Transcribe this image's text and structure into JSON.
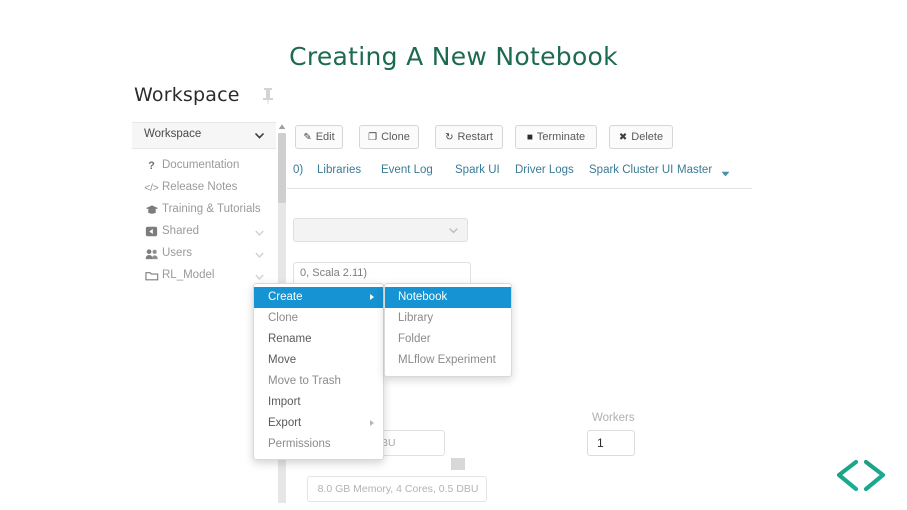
{
  "slide": {
    "title": "Creating A New Notebook",
    "title_color": "#1d6b4f"
  },
  "workspace_panel": {
    "header_title": "Workspace",
    "pin_icon": "pin-icon",
    "selector": {
      "label": "Workspace",
      "caret_icon": "chevron-down-icon"
    },
    "items": [
      {
        "label": "Documentation",
        "icon": "question-mark-icon",
        "has_caret": false
      },
      {
        "label": "Release Notes",
        "icon": "code-brackets-icon",
        "has_caret": false
      },
      {
        "label": "Training & Tutorials",
        "icon": "graduation-cap-icon",
        "has_caret": false
      },
      {
        "label": "Shared",
        "icon": "share-icon",
        "has_caret": true
      },
      {
        "label": "Users",
        "icon": "users-icon",
        "has_caret": true
      },
      {
        "label": "RL_Model",
        "icon": "folder-icon",
        "has_caret": true
      }
    ]
  },
  "cluster_page": {
    "toolbar": [
      {
        "label": "Edit",
        "icon": "pencil-edit-icon"
      },
      {
        "label": "Clone",
        "icon": "clone-icon"
      },
      {
        "label": "Restart",
        "icon": "restart-refresh-icon"
      },
      {
        "label": "Terminate",
        "icon": "stop-square-icon"
      },
      {
        "label": "Delete",
        "icon": "close-x-icon"
      }
    ],
    "tabs": [
      {
        "label": "0)"
      },
      {
        "label": "Libraries"
      },
      {
        "label": "Event Log"
      },
      {
        "label": "Spark UI"
      },
      {
        "label": "Driver Logs"
      },
      {
        "label": "Spark Cluster UI - Master",
        "short": "Spark Cluster UI",
        "suffix": "Master"
      }
    ],
    "tab_master_caret": "caret-down-icon",
    "select_value": "",
    "select_caret": "chevron-down-icon",
    "runtime_text": "0, Scala 2.11)",
    "worker_chip_text": "Cores, 0.5 DBU",
    "workers_label": "Workers",
    "workers_value": "1",
    "driver_chip_text": "8.0 GB Memory, 4 Cores, 0.5 DBU"
  },
  "context_menu": {
    "highlight_color": "#1593d3",
    "items": [
      {
        "label": "Create",
        "active": true,
        "submenu": true
      },
      {
        "label": "Clone",
        "active": false,
        "submenu": false
      },
      {
        "label": "Rename",
        "active": false,
        "submenu": false
      },
      {
        "label": "Move",
        "active": false,
        "submenu": false
      },
      {
        "label": "Move to Trash",
        "active": false,
        "submenu": false
      },
      {
        "label": "Import",
        "active": false,
        "submenu": false
      },
      {
        "label": "Export",
        "active": false,
        "submenu": true
      },
      {
        "label": "Permissions",
        "active": false,
        "submenu": false
      }
    ],
    "submenu_items": [
      {
        "label": "Notebook",
        "active": true
      },
      {
        "label": "Library",
        "active": false
      },
      {
        "label": "Folder",
        "active": false
      },
      {
        "label": "MLflow Experiment",
        "active": false
      }
    ]
  },
  "branding": {
    "logo_icon": "code-brackets-logo",
    "logo_color_left": "#1f9e7e",
    "logo_color_right": "#17b09a"
  }
}
